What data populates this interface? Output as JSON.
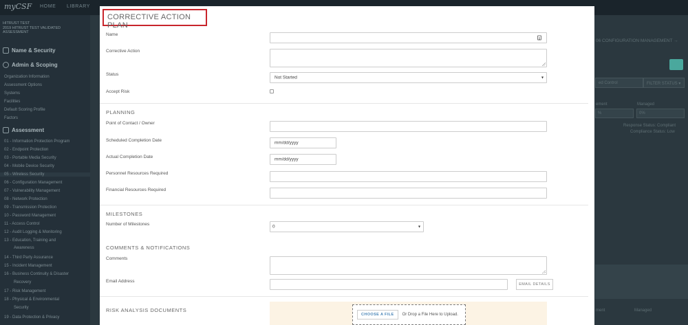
{
  "app": {
    "logo": "myCSF",
    "nav": [
      "HOME",
      "LIBRARY"
    ]
  },
  "sidebar": {
    "header_lines": [
      "HITRUST TEST",
      "2019 HITRUST TEST VALIDATED",
      "ASSESSMENT"
    ],
    "sections": [
      {
        "label": "Name & Security",
        "icon": "lock-icon"
      },
      {
        "label": "Admin & Scoping",
        "icon": "gear-icon"
      }
    ],
    "admin_items": [
      "Organization Information",
      "Assessment Options",
      "Systems",
      "Facilities",
      "Default Scoring Profile",
      "Factors"
    ],
    "assessment_label": "Assessment",
    "assessment_items": [
      "01 - Information Protection Program",
      "02 - Endpoint Protection",
      "03 - Portable Media Security",
      "04 - Mobile Device Security",
      "05 - Wireless Security",
      "06 - Configuration Management",
      "07 - Vulnerability Management",
      "08 - Network Protection",
      "09 - Transmission Protection",
      "10 - Password Management",
      "11 - Access Control",
      "12 - Audit Logging & Monitoring",
      "13 - Education, Training and",
      "Awareness",
      "14 - Third Party Assurance",
      "15 - Incident Management",
      "16 - Business Continuity & Disaster",
      "Recovery",
      "17 - Risk Management",
      "18 - Physical & Environmental",
      "Security",
      "19 - Data Protection & Privacy"
    ]
  },
  "background": {
    "link": "06 CONFIGURATION MANAGEMENT →",
    "filter_select": "ed Control",
    "filter_status": "FILTER STATUS ▾",
    "col_a": "ement",
    "col_b": "Managed",
    "select_a": "%",
    "select_b": "0%",
    "response_status": "Response Status: Compliant",
    "compliance_status": "Compliance Status: Low",
    "bottom_col_a": "ment",
    "bottom_col_b": "Managed"
  },
  "modal": {
    "title": "CORRECTIVE ACTION PLAN",
    "fields": {
      "name_label": "Name",
      "corrective_action_label": "Corrective Action",
      "status_label": "Status",
      "status_value": "Not Started",
      "accept_risk_label": "Accept Risk"
    },
    "planning": {
      "heading": "PLANNING",
      "poc_label": "Point of Contact / Owner",
      "scheduled_label": "Scheduled Completion Date",
      "scheduled_placeholder": "mm/dd/yyyy",
      "actual_label": "Actual Completion Date",
      "actual_placeholder": "mm/dd/yyyy",
      "personnel_label": "Personnel Resources Required",
      "financial_label": "Financial Resources Required"
    },
    "milestones": {
      "heading": "MILESTONES",
      "count_label": "Number of Milestones",
      "count_value": "0"
    },
    "comments": {
      "heading": "COMMENTS & NOTIFICATIONS",
      "comments_label": "Comments",
      "email_label": "Email Address",
      "email_button": "EMAIL DETAILS"
    },
    "risk_docs": {
      "heading": "RISK ANALYSIS DOCUMENTS",
      "choose_button": "CHOOSE A FILE",
      "drop_text": "Or Drop a File Here to Upload."
    }
  }
}
